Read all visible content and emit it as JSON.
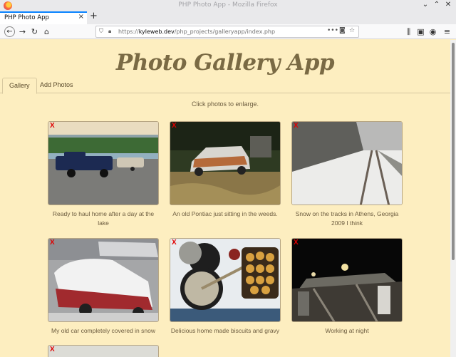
{
  "browser": {
    "window_title": "PHP Photo App - Mozilla Firefox",
    "tab_title": "PHP Photo App",
    "url_prefix": "https://",
    "url_domain": "kyleweb.dev",
    "url_path": "/php_projects/galleryapp/index.php",
    "url_dots": "•••",
    "new_tab_glyph": "+",
    "close_glyph": "×"
  },
  "page": {
    "title": "Photo Gallery App",
    "tabs": [
      {
        "label": "Gallery"
      },
      {
        "label": "Add Photos"
      }
    ],
    "hint": "Click photos to enlarge.",
    "delete_glyph": "X",
    "photos": [
      {
        "caption": "Ready to haul home after a day at the lake"
      },
      {
        "caption": "An old Pontiac just sitting in the weeds."
      },
      {
        "caption": "Snow on the tracks in Athens, Georgia 2009 I think"
      },
      {
        "caption": "My old car completely covered in snow"
      },
      {
        "caption": "Delicious home made biscuits and gravy"
      },
      {
        "caption": "Working at night"
      }
    ]
  },
  "icons": [
    "firefox-logo",
    "minimize-icon",
    "maximize-icon",
    "close-icon",
    "back-icon",
    "forward-icon",
    "reload-icon",
    "home-icon",
    "shield-icon",
    "lock-icon",
    "pocket-icon",
    "star-icon",
    "library-icon",
    "sidebar-icon",
    "account-icon",
    "menu-icon"
  ]
}
